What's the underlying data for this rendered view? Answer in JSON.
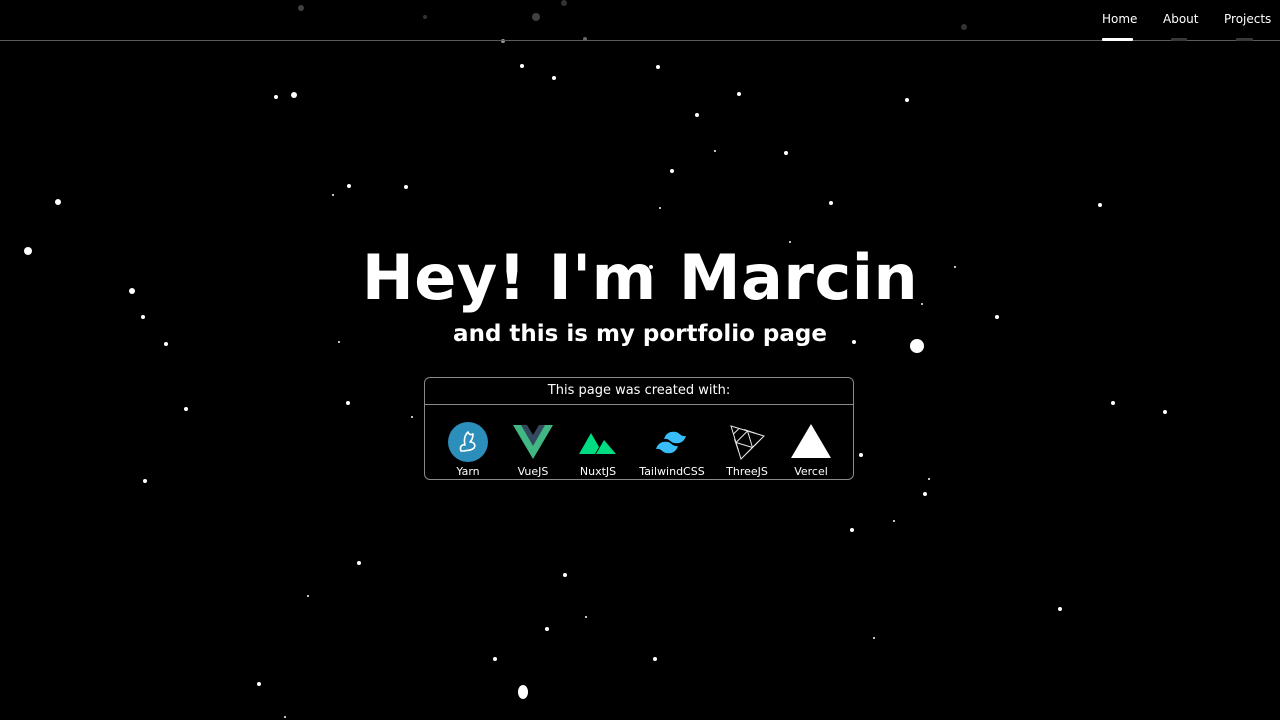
{
  "nav": {
    "items": [
      {
        "label": "Home",
        "active": true
      },
      {
        "label": "About",
        "active": false
      },
      {
        "label": "Projects",
        "active": false
      }
    ]
  },
  "hero": {
    "title": "Hey! I'm Marcin",
    "subtitle": "and this is my portfolio page"
  },
  "tech_stack": {
    "title": "This page was created with:",
    "items": [
      {
        "label": "Yarn",
        "icon": "yarn-icon",
        "color": "#2c8ebb"
      },
      {
        "label": "VueJS",
        "icon": "vue-icon",
        "color": "#41b883"
      },
      {
        "label": "NuxtJS",
        "icon": "nuxt-icon",
        "color": "#00dc82"
      },
      {
        "label": "TailwindCSS",
        "icon": "tailwind-icon",
        "color": "#38bdf8"
      },
      {
        "label": "ThreeJS",
        "icon": "threejs-icon",
        "color": "#ffffff"
      },
      {
        "label": "Vercel",
        "icon": "vercel-icon",
        "color": "#ffffff"
      }
    ]
  },
  "colors": {
    "background": "#000000",
    "text": "#ffffff",
    "border": "#8a8a8a"
  }
}
